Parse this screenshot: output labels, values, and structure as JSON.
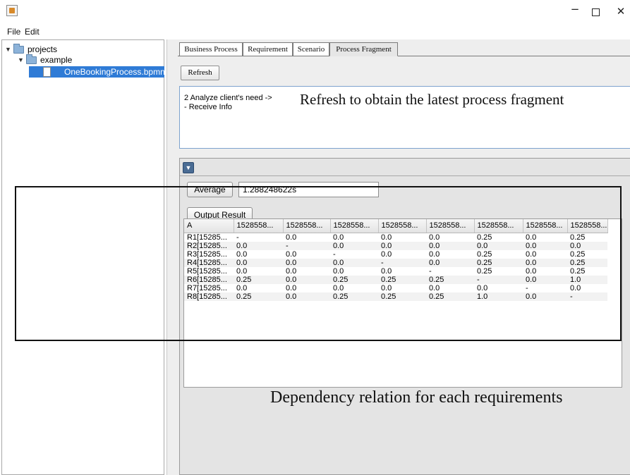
{
  "window": {
    "icon": "java-cup-icon",
    "controls": {
      "minimize": "−",
      "maximize": "☐",
      "close": "✕"
    }
  },
  "menu": {
    "items": [
      "File",
      "Edit"
    ]
  },
  "tree": {
    "root": "projects",
    "folder": "example",
    "file": "OneBookingProcess.bpmn"
  },
  "tabs": [
    "Business Process",
    "Requirement",
    "Scenario",
    "Process Fragment"
  ],
  "active_tab": "Process Fragment",
  "refresh_label": "Refresh",
  "fragment_text": "2 Analyze client's need ->\n- Receive Info",
  "annotation_refresh": "Refresh to obtain the latest process fragment",
  "average": {
    "button": "Average",
    "value": "1.288248622s"
  },
  "output_result_label": "Output Result",
  "table": {
    "headers": [
      "A",
      "1528558...",
      "1528558...",
      "1528558...",
      "1528558...",
      "1528558...",
      "1528558...",
      "1528558...",
      "1528558..."
    ],
    "rows": [
      [
        "R1[15285...",
        "-",
        "0.0",
        "0.0",
        "0.0",
        "0.0",
        "0.25",
        "0.0",
        "0.25"
      ],
      [
        "R2[15285...",
        "0.0",
        "-",
        "0.0",
        "0.0",
        "0.0",
        "0.0",
        "0.0",
        "0.0"
      ],
      [
        "R3[15285...",
        "0.0",
        "0.0",
        "-",
        "0.0",
        "0.0",
        "0.25",
        "0.0",
        "0.25"
      ],
      [
        "R4[15285...",
        "0.0",
        "0.0",
        "0.0",
        "-",
        "0.0",
        "0.25",
        "0.0",
        "0.25"
      ],
      [
        "R5[15285...",
        "0.0",
        "0.0",
        "0.0",
        "0.0",
        "-",
        "0.25",
        "0.0",
        "0.25"
      ],
      [
        "R6[15285...",
        "0.25",
        "0.0",
        "0.25",
        "0.25",
        "0.25",
        "-",
        "0.0",
        "1.0"
      ],
      [
        "R7[15285...",
        "0.0",
        "0.0",
        "0.0",
        "0.0",
        "0.0",
        "0.0",
        "-",
        "0.0"
      ],
      [
        "R8[15285...",
        "0.25",
        "0.0",
        "0.25",
        "0.25",
        "0.25",
        "1.0",
        "0.0",
        "-"
      ]
    ]
  },
  "annotation_dependency": "Dependency relation for each requirements",
  "colors": {
    "selection": "#2f7bd6",
    "frame_border": "#7da2ce",
    "panel_bg": "#eeeeee"
  }
}
